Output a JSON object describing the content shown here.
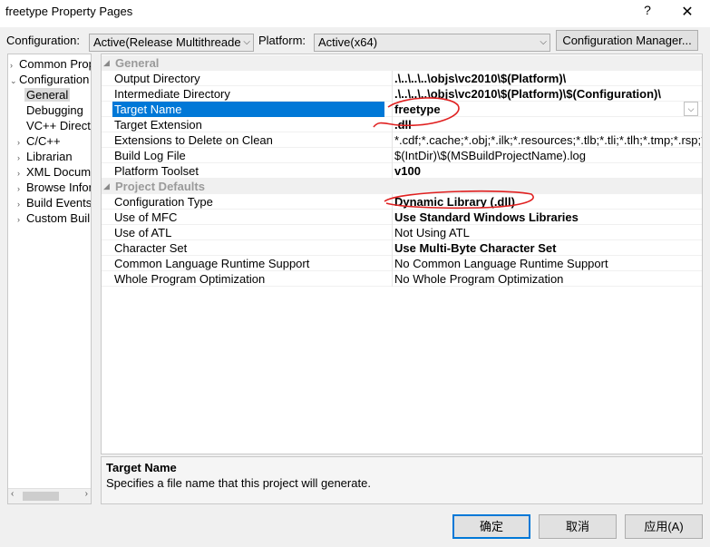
{
  "window": {
    "title": "freetype Property Pages",
    "help_glyph": "?",
    "close_glyph": "✕"
  },
  "toolbar": {
    "configuration_label": "Configuration:",
    "configuration_value": "Active(Release Multithreade",
    "platform_label": "Platform:",
    "platform_value": "Active(x64)",
    "config_manager_label": "Configuration Manager..."
  },
  "tree": {
    "items": [
      {
        "label": "Common Prop",
        "exp": "›"
      },
      {
        "label": "Configuration",
        "exp": "⌄"
      },
      {
        "label": "General",
        "exp": ""
      },
      {
        "label": "Debugging",
        "exp": ""
      },
      {
        "label": "VC++ Direct",
        "exp": ""
      },
      {
        "label": "C/C++",
        "exp": "›"
      },
      {
        "label": "Librarian",
        "exp": "›"
      },
      {
        "label": "XML Docum",
        "exp": "›"
      },
      {
        "label": "Browse Infor",
        "exp": "›"
      },
      {
        "label": "Build Events",
        "exp": "›"
      },
      {
        "label": "Custom Buil",
        "exp": "›"
      }
    ]
  },
  "grid": {
    "categories": {
      "general": "General",
      "project_defaults": "Project Defaults"
    },
    "rows": [
      {
        "name": "Output Directory",
        "value": ".\\..\\..\\..\\objs\\vc2010\\$(Platform)\\"
      },
      {
        "name": "Intermediate Directory",
        "value": ".\\..\\..\\..\\objs\\vc2010\\$(Platform)\\$(Configuration)\\"
      },
      {
        "name": "Target Name",
        "value": "freetype"
      },
      {
        "name": "Target Extension",
        "value": ".dll"
      },
      {
        "name": "Extensions to Delete on Clean",
        "value": "*.cdf;*.cache;*.obj;*.ilk;*.resources;*.tlb;*.tli;*.tlh;*.tmp;*.rsp;*."
      },
      {
        "name": "Build Log File",
        "value": "$(IntDir)\\$(MSBuildProjectName).log"
      },
      {
        "name": "Platform Toolset",
        "value": "v100"
      },
      {
        "name": "Configuration Type",
        "value": "Dynamic Library (.dll)"
      },
      {
        "name": "Use of MFC",
        "value": "Use Standard Windows Libraries"
      },
      {
        "name": "Use of ATL",
        "value": "Not Using ATL"
      },
      {
        "name": "Character Set",
        "value": "Use Multi-Byte Character Set"
      },
      {
        "name": "Common Language Runtime Support",
        "value": "No Common Language Runtime Support"
      },
      {
        "name": "Whole Program Optimization",
        "value": "No Whole Program Optimization"
      }
    ]
  },
  "description": {
    "title": "Target Name",
    "text": "Specifies a file name that this project will generate."
  },
  "buttons": {
    "ok": "确定",
    "cancel": "取消",
    "apply": "应用(A)"
  },
  "colors": {
    "selection": "#0078d7",
    "annotation": "#e02020"
  }
}
